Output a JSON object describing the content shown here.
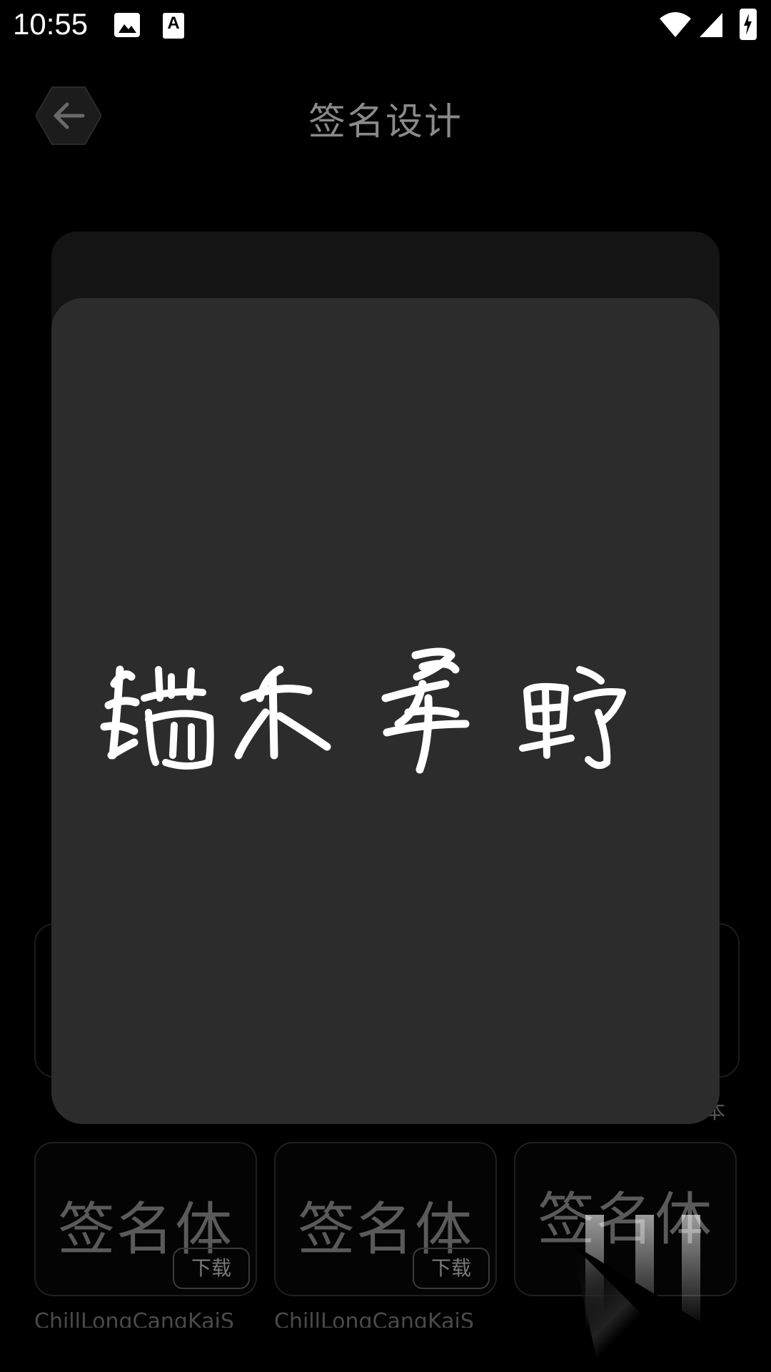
{
  "status_bar": {
    "time": "10:55",
    "icons": [
      "gallery-icon",
      "font-a-icon",
      "wifi-icon",
      "signal-icon",
      "battery-charging-icon"
    ]
  },
  "header": {
    "title": "签名设计",
    "back_icon": "arrow-left-icon"
  },
  "preview": {
    "signature_text": "端木星野"
  },
  "background_page": {
    "partial_label": "本",
    "font_cards": [
      {
        "sample": "签名体",
        "button": "下载",
        "name": "ChillLongCangKaiS"
      },
      {
        "sample": "签名体",
        "button": "下载",
        "name": "ChillLongCangKaiS"
      },
      {
        "sample": "签名体",
        "button": "",
        "name": ""
      }
    ]
  },
  "colors": {
    "background": "#000000",
    "card": "#2c2c2c",
    "title": "#8a8a8a"
  }
}
